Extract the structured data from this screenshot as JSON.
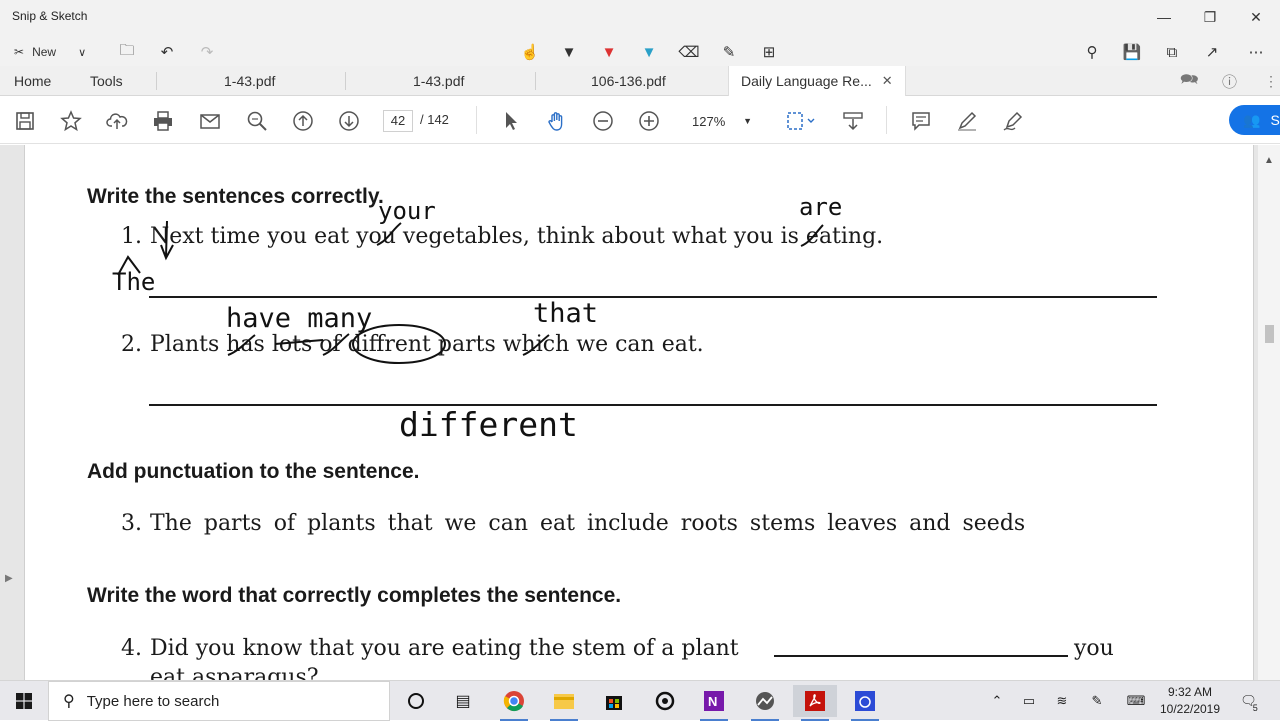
{
  "app_title": "Snip & Sketch",
  "snip_toolbar": {
    "new_label": "New"
  },
  "tabs": {
    "home": "Home",
    "tools": "Tools",
    "doc1": "1-43.pdf",
    "doc2": "1-43.pdf",
    "doc3": "106-136.pdf",
    "doc4": "Daily Language Re..."
  },
  "acrobat_toolbar": {
    "page_current": "42",
    "page_total": "/ 142",
    "zoom": "127%",
    "share_label": "S"
  },
  "document": {
    "heading1": "Write the sentences correctly.",
    "s1_num": "1.",
    "s1_text": "Next time you eat you vegetables, think about what you is eating.",
    "s2_num": "2.",
    "s2_text": "Plants has lots of diffrent parts which we can eat.",
    "heading2": "Add punctuation to the sentence.",
    "s3_num": "3.",
    "s3_text": "The parts of plants that we can eat include roots stems leaves and seeds",
    "heading3": "Write the word that correctly completes the sentence.",
    "s4_num": "4.",
    "s4_text": "Did you know that you are eating the stem of a plant",
    "s4_after": "you",
    "s4_line2": "eat asparagus?"
  },
  "handwriting": {
    "your": "your",
    "are": "are",
    "the": "The",
    "have_many": "have many",
    "that": "that",
    "different": "different"
  },
  "taskbar": {
    "search_placeholder": "Type here to search",
    "time": "9:32 AM",
    "date": "10/22/2019",
    "notifications": "5"
  }
}
